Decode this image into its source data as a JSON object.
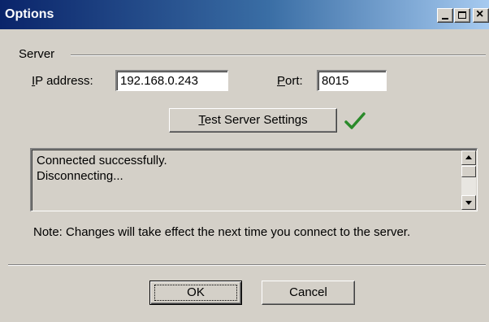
{
  "window": {
    "title": "Options",
    "controls": [
      "minimize-icon",
      "maximize-icon",
      "close-icon"
    ],
    "close_glyph": "×"
  },
  "server": {
    "group_label": "Server",
    "ip_label_accel": "I",
    "ip_label_rest": "P address:",
    "ip_value": "192.168.0.243",
    "port_label_accel": "P",
    "port_label_rest": "ort:",
    "port_value": "8015",
    "test_button_accel": "T",
    "test_button_rest": "est Server Settings",
    "test_status_icon": "checkmark-icon",
    "test_status_color": "#2a8a2a"
  },
  "log": {
    "lines": [
      "Connected successfully.",
      "Disconnecting..."
    ]
  },
  "note": "Note: Changes will take effect the next time you connect to the server.",
  "buttons": {
    "ok": "OK",
    "cancel": "Cancel"
  }
}
